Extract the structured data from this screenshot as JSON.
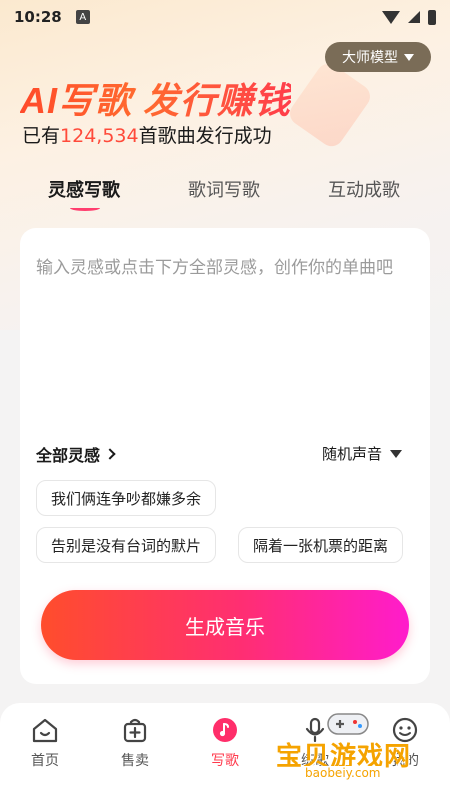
{
  "status_bar": {
    "time": "10:28",
    "notification_letter": "A"
  },
  "model_selector": {
    "label": "大师模型"
  },
  "hero": {
    "headline": "AI写歌 发行赚钱",
    "sub_prefix": "已有",
    "sub_count": "124,534",
    "sub_suffix": "首歌曲发行成功"
  },
  "tabs": [
    {
      "label": "灵感写歌",
      "active": true
    },
    {
      "label": "歌词写歌",
      "active": false
    },
    {
      "label": "互动成歌",
      "active": false
    }
  ],
  "editor": {
    "placeholder": "输入灵感或点击下方全部灵感，创作你的单曲吧",
    "all_inspiration_label": "全部灵感",
    "voice_label": "随机声音"
  },
  "inspiration_chips": [
    "我们俩连争吵都嫌多余",
    "告别是没有台词的默片",
    "隔着一张机票的距离"
  ],
  "generate_button": {
    "label": "生成音乐"
  },
  "bottom_nav": [
    {
      "label": "首页",
      "icon": "home-icon"
    },
    {
      "label": "售卖",
      "icon": "shop-bag-icon"
    },
    {
      "label": "写歌",
      "icon": "music-note-icon",
      "active": true
    },
    {
      "label": "练歌",
      "icon": "mic-icon"
    },
    {
      "label": "我的",
      "icon": "profile-face-icon"
    }
  ],
  "watermark": {
    "text": "宝贝游戏网",
    "url": "baobeiy.com"
  },
  "colors": {
    "accent": "#ff3a4c",
    "gradient_start": "#ff4d2c",
    "gradient_end": "#ff1ccc"
  }
}
